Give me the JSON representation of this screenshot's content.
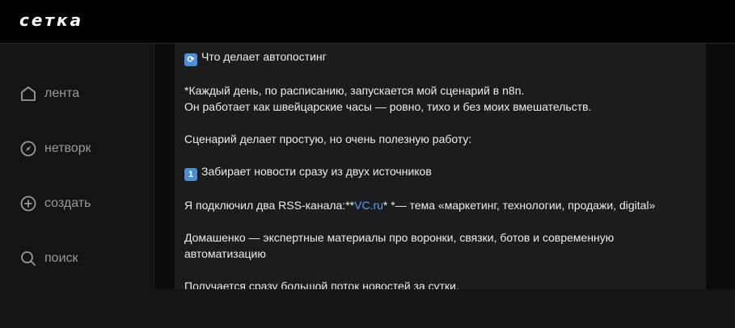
{
  "app": {
    "logo": "сетка"
  },
  "sidebar": {
    "items": [
      {
        "label": "лента",
        "icon": "home-icon"
      },
      {
        "label": "нетворк",
        "icon": "compass-icon"
      },
      {
        "label": "создать",
        "icon": "plus-circle-icon"
      },
      {
        "label": "поиск",
        "icon": "search-icon"
      }
    ]
  },
  "post": {
    "heading_emoji": "🔄",
    "heading": "Что делает автопостинг",
    "p1_line1": "*Каждый день, по расписанию, запускается мой сценарий в n8n.",
    "p1_line2": "Он работает как швейцарские часы — ровно, тихо и без моих вмешательств.",
    "p2": "Сценарий делает простую, но очень полезную работу:",
    "step1_emoji": "1",
    "step1": "Забирает новости сразу из двух источников",
    "rss_prefix": "Я подключил два RSS-канала:**",
    "rss_link": "VC.ru",
    "rss_suffix": "* *— тема «маркетинг, технологии, продажи, digital»",
    "p5": "Домашенко — экспертные материалы про воронки, связки, ботов и современную автоматизацию",
    "p6": "Получается сразу большой поток новостей за сутки."
  }
}
